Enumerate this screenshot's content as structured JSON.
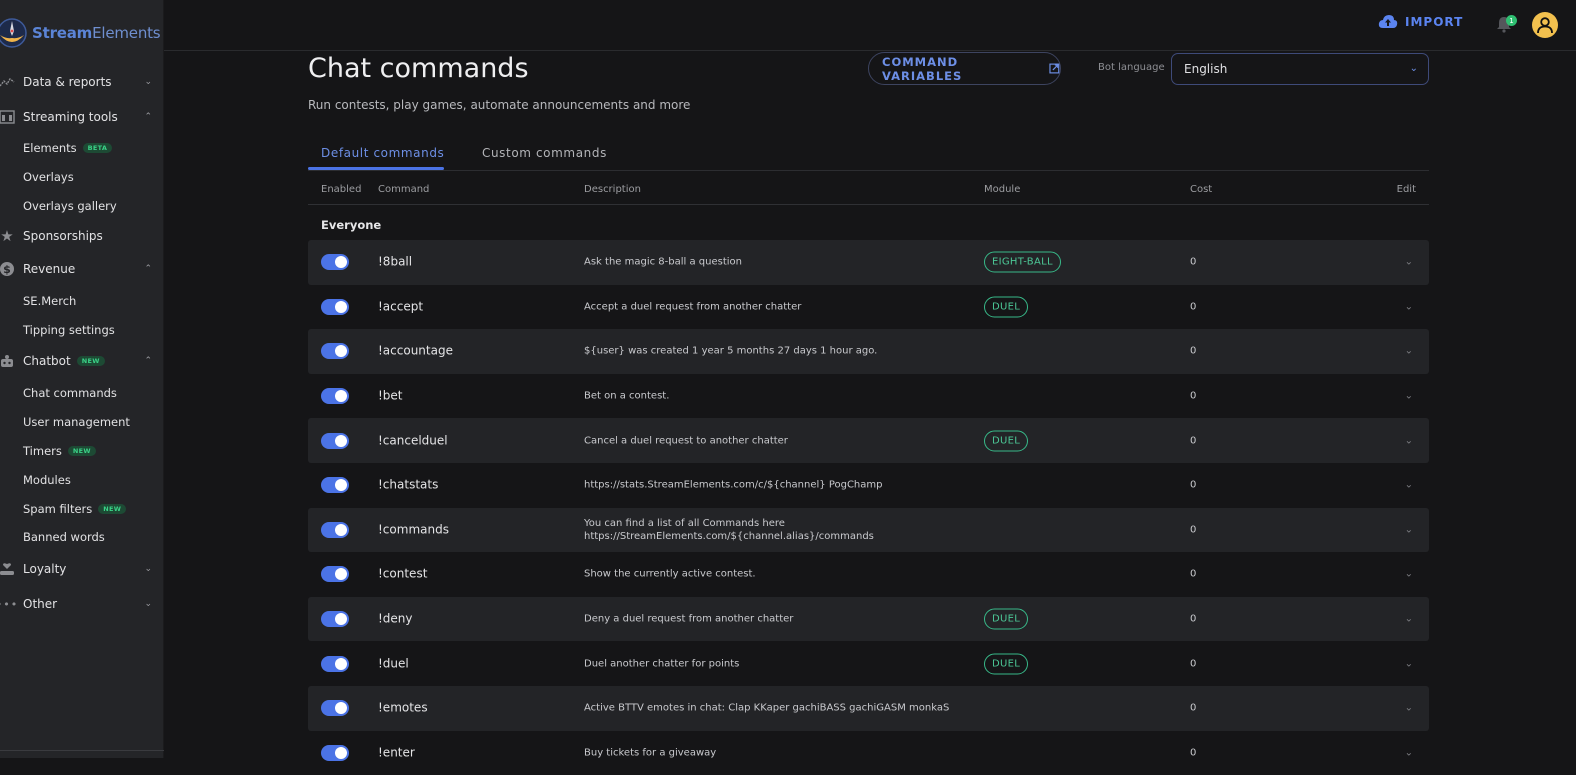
{
  "app": {
    "brand_bold": "Stream",
    "brand_light": "Elements"
  },
  "sidebar": {
    "groups": [
      {
        "label": "Data & reports",
        "icon": "chart-line-icon",
        "expanded": false
      },
      {
        "label": "Streaming tools",
        "icon": "streaming-tools-icon",
        "expanded": true,
        "items": [
          {
            "label": "Elements",
            "badge": "BETA"
          },
          {
            "label": "Overlays"
          },
          {
            "label": "Overlays gallery"
          }
        ]
      },
      {
        "label": "Sponsorships",
        "icon": "star-icon"
      },
      {
        "label": "Revenue",
        "icon": "dollar-icon",
        "expanded": true,
        "items": [
          {
            "label": "SE.Merch"
          },
          {
            "label": "Tipping settings"
          }
        ]
      },
      {
        "label": "Chatbot",
        "badge": "NEW",
        "icon": "robot-icon",
        "expanded": true,
        "items": [
          {
            "label": "Chat commands"
          },
          {
            "label": "User management"
          },
          {
            "label": "Timers",
            "badge": "NEW"
          },
          {
            "label": "Modules"
          },
          {
            "label": "Spam filters",
            "badge": "NEW"
          },
          {
            "label": "Banned words"
          }
        ]
      },
      {
        "label": "Loyalty",
        "icon": "loyalty-icon",
        "expanded": false
      },
      {
        "label": "Other",
        "icon": "more-icon",
        "expanded": false
      }
    ]
  },
  "topbar": {
    "import_label": "IMPORT",
    "notification_count": "1"
  },
  "page": {
    "title": "Chat commands",
    "subtitle": "Run contests, play games, automate announcements and more",
    "command_variables_label": "COMMAND VARIABLES",
    "bot_language_label": "Bot language",
    "bot_language_value": "English"
  },
  "tabs": [
    {
      "label": "Default commands",
      "active": true
    },
    {
      "label": "Custom commands",
      "active": false
    }
  ],
  "table": {
    "headers": {
      "enabled": "Enabled",
      "command": "Command",
      "description": "Description",
      "module": "Module",
      "cost": "Cost",
      "edit": "Edit"
    },
    "group_label": "Everyone",
    "rows": [
      {
        "command": "!8ball",
        "description": "Ask the magic 8-ball a question",
        "module": "EIGHT-BALL",
        "cost": "0",
        "enabled": true
      },
      {
        "command": "!accept",
        "description": "Accept a duel request from another chatter",
        "module": "DUEL",
        "cost": "0",
        "enabled": true
      },
      {
        "command": "!accountage",
        "description": "${user} was created 1 year 5 months 27 days 1 hour ago.",
        "module": "",
        "cost": "0",
        "enabled": true
      },
      {
        "command": "!bet",
        "description": "Bet on a contest.",
        "module": "",
        "cost": "0",
        "enabled": true
      },
      {
        "command": "!cancelduel",
        "description": "Cancel a duel request to another chatter",
        "module": "DUEL",
        "cost": "0",
        "enabled": true
      },
      {
        "command": "!chatstats",
        "description": "https://stats.StreamElements.com/c/${channel} PogChamp",
        "module": "",
        "cost": "0",
        "enabled": true
      },
      {
        "command": "!commands",
        "description": "You can find a list of all Commands here https://StreamElements.com/${channel.alias}/commands",
        "module": "",
        "cost": "0",
        "enabled": true
      },
      {
        "command": "!contest",
        "description": "Show the currently active contest.",
        "module": "",
        "cost": "0",
        "enabled": true
      },
      {
        "command": "!deny",
        "description": "Deny a duel request from another chatter",
        "module": "DUEL",
        "cost": "0",
        "enabled": true
      },
      {
        "command": "!duel",
        "description": "Duel another chatter for points",
        "module": "DUEL",
        "cost": "0",
        "enabled": true
      },
      {
        "command": "!emotes",
        "description": "Active BTTV emotes in chat: Clap KKaper gachiBASS gachiGASM monkaS",
        "module": "",
        "cost": "0",
        "enabled": true
      },
      {
        "command": "!enter",
        "description": "Buy tickets for a giveaway",
        "module": "",
        "cost": "0",
        "enabled": true
      }
    ]
  },
  "colors": {
    "accent": "#4b73e6",
    "module_badge": "#38b989",
    "avatar": "#f2c04e",
    "new_badge": "#3ad287"
  }
}
